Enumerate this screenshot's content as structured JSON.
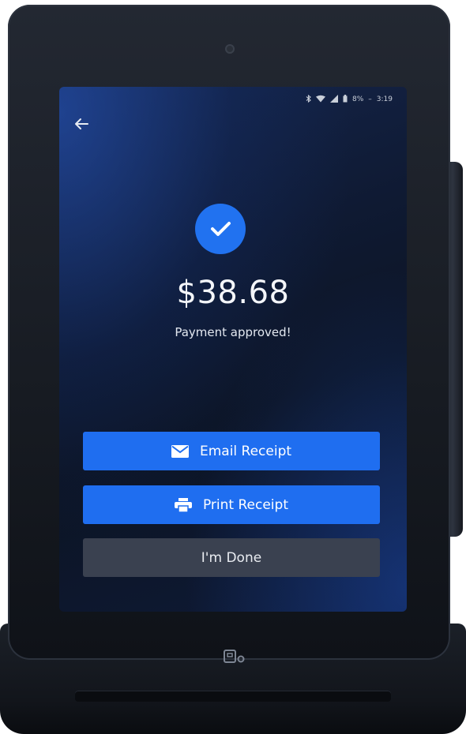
{
  "status_bar": {
    "battery": "8%",
    "time": "3:19"
  },
  "payment": {
    "amount": "$38.68",
    "message": "Payment approved!"
  },
  "buttons": {
    "email_label": "Email Receipt",
    "print_label": "Print Receipt",
    "done_label": "I'm Done"
  },
  "icons": {
    "back": "arrow-left-icon",
    "check": "checkmark-icon",
    "email": "envelope-icon",
    "print": "printer-icon",
    "home": "home-button-icon"
  },
  "colors": {
    "accent": "#1f6ef0",
    "secondary_button": "#3a4150"
  }
}
